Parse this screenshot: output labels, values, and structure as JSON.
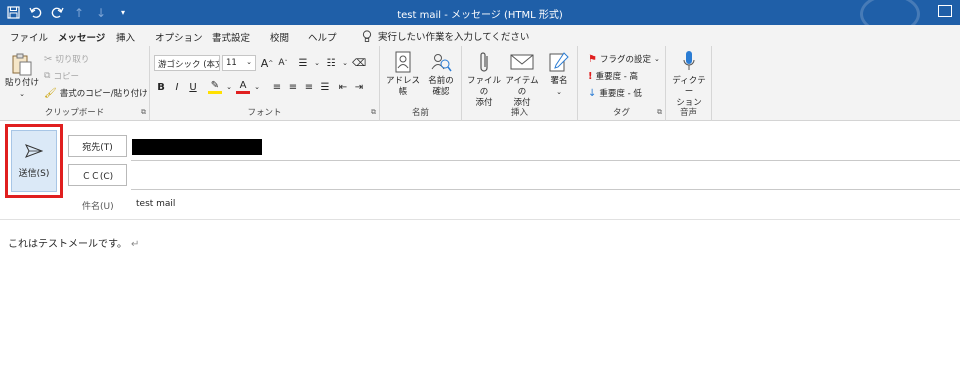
{
  "window": {
    "title": "test mail  -  メッセージ (HTML 形式)"
  },
  "quick_access": {
    "icons": [
      "save-icon",
      "undo-icon",
      "redo-icon",
      "up-icon",
      "down-icon",
      "customize-icon"
    ]
  },
  "tabs": [
    "ファイル",
    "メッセージ",
    "挿入",
    "オプション",
    "書式設定",
    "校閲",
    "ヘルプ"
  ],
  "active_tab": "メッセージ",
  "tell_me": "実行したい作業を入力してください",
  "ribbon": {
    "clipboard": {
      "label": "クリップボード",
      "paste": "貼り付け",
      "cut": "切り取り",
      "copy": "コピー",
      "format_painter": "書式のコピー/貼り付け"
    },
    "font": {
      "label": "フォント",
      "font_name": "游ゴシック (本文",
      "font_size": "11",
      "grow": "A",
      "shrink": "A",
      "bold": "B",
      "italic": "I",
      "underline": "U",
      "font_color": "A"
    },
    "names": {
      "label": "名前",
      "address_book": "アドレス帳",
      "check_names_1": "名前の",
      "check_names_2": "確認"
    },
    "insert": {
      "label": "挿入",
      "attach_file_1": "ファイルの",
      "attach_file_2": "添付",
      "attach_item_1": "アイテムの",
      "attach_item_2": "添付",
      "signature": "署名"
    },
    "tags": {
      "label": "タグ",
      "follow_up": "フラグの設定",
      "high": "重要度 - 高",
      "low": "重要度 - 低"
    },
    "voice": {
      "label": "音声",
      "dictate_1": "ディクテー",
      "dictate_2": "ション"
    }
  },
  "compose": {
    "send": "送信(S)",
    "to": "宛先(T)",
    "cc": "ＣＣ(C)",
    "subject_label": "件名(U)",
    "subject": "test mail",
    "body": "これはテストメールです。",
    "return_mark": "↵"
  },
  "colors": {
    "titlebar": "#1f5fa8",
    "highlight_box": "#e01f1f",
    "send_bg": "#dbe9f7"
  }
}
